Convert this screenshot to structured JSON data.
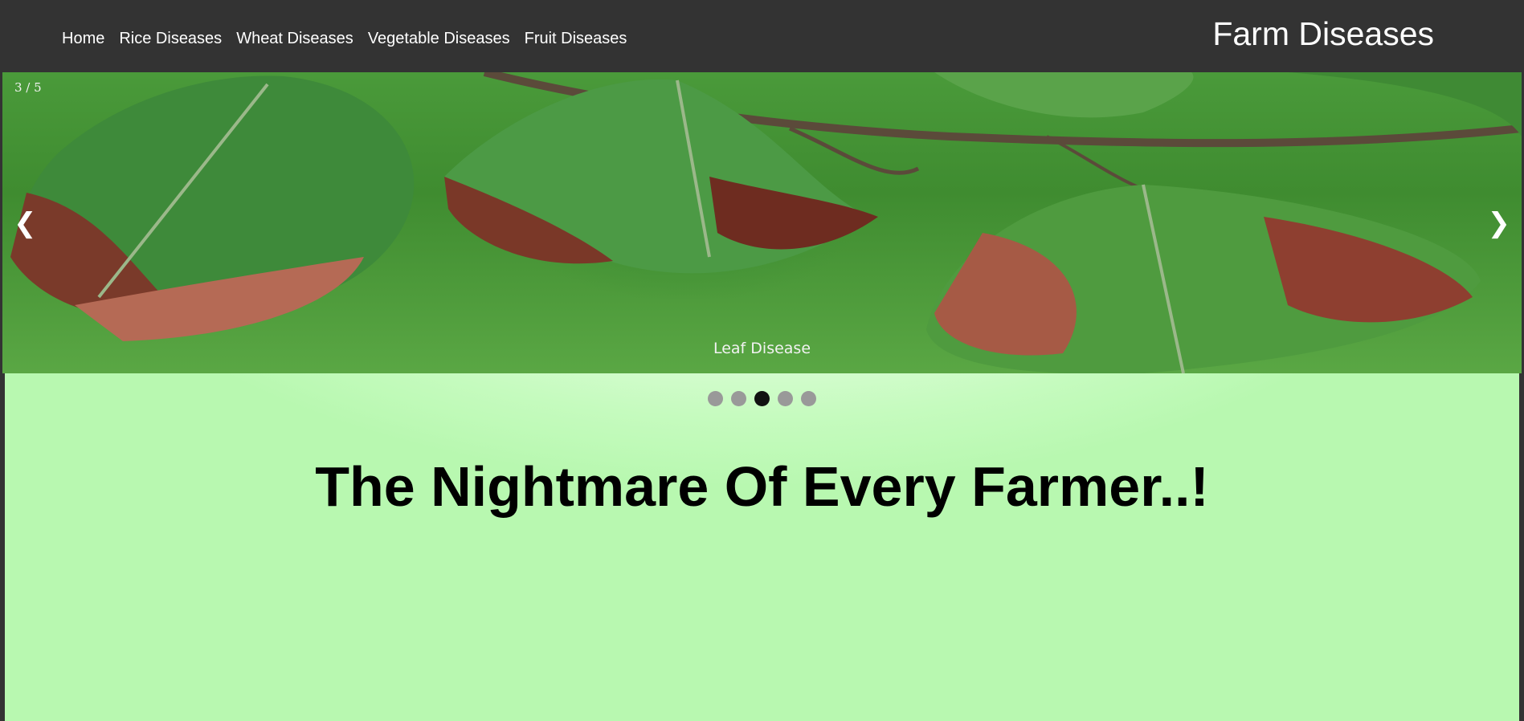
{
  "nav": {
    "items": [
      {
        "label": "Home"
      },
      {
        "label": "Rice Diseases"
      },
      {
        "label": "Wheat Diseases"
      },
      {
        "label": "Vegetable Diseases"
      },
      {
        "label": "Fruit Diseases"
      }
    ],
    "brand": "Farm Diseases"
  },
  "slideshow": {
    "counter": "3 / 5",
    "caption": "Leaf Disease",
    "prev_icon": "❯",
    "next_icon": "❯",
    "total_slides": 5,
    "active_slide": 3
  },
  "main": {
    "headline": "The Nightmare Of Every Farmer..!"
  },
  "colors": {
    "navbar": "#333333",
    "dot_inactive": "#999999",
    "dot_active": "#111111",
    "background_light": "#ffffff",
    "background_green": "#b8f8b0"
  }
}
